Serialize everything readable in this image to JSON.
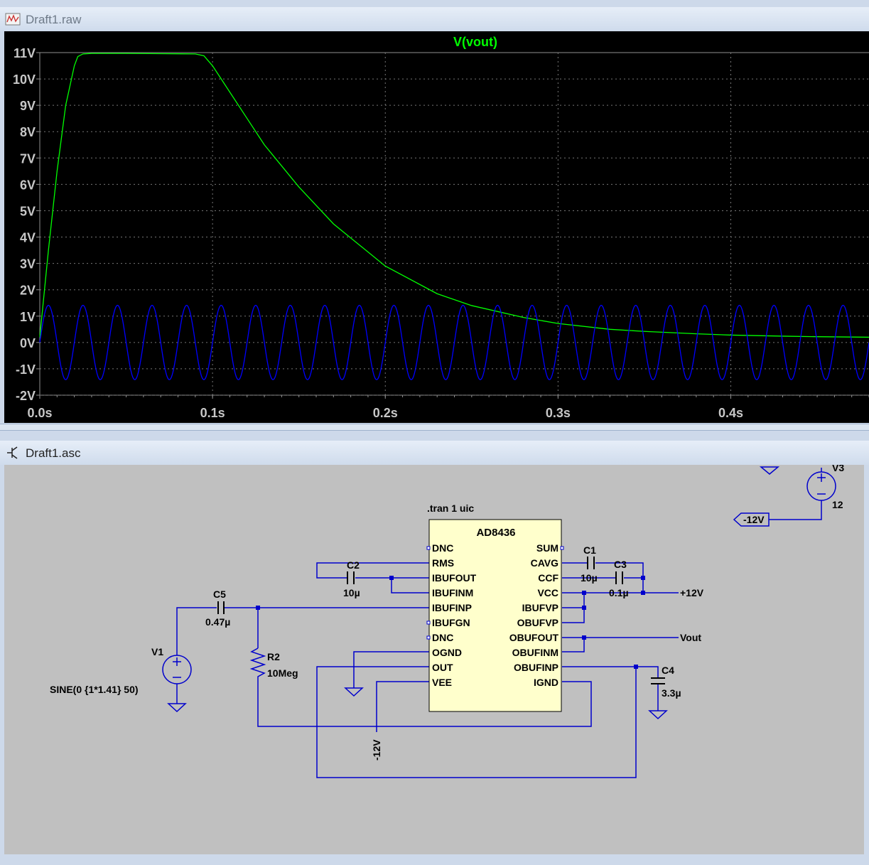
{
  "waveform_window": {
    "title": "Draft1.raw",
    "trace_label": "V(vout)"
  },
  "schematic_window": {
    "title": "Draft1.asc",
    "directive": ".tran 1 uic",
    "ic": {
      "name": "AD8436",
      "left_pins": [
        "DNC",
        "RMS",
        "IBUFOUT",
        "IBUFINM",
        "IBUFINP",
        "IBUFGN",
        "DNC",
        "OGND",
        "OUT",
        "VEE"
      ],
      "right_pins": [
        "SUM",
        "CAVG",
        "CCF",
        "VCC",
        "IBUFVP",
        "OBUFVP",
        "OBUFOUT",
        "OBUFINM",
        "OBUFINP",
        "IGND"
      ]
    },
    "components": {
      "c1": {
        "name": "C1",
        "value": "10µ"
      },
      "c2": {
        "name": "C2",
        "value": "10µ"
      },
      "c3": {
        "name": "C3",
        "value": "0.1µ"
      },
      "c4": {
        "name": "C4",
        "value": "3.3µ"
      },
      "c5": {
        "name": "C5",
        "value": "0.47µ"
      },
      "r2": {
        "name": "R2",
        "value": "10Meg"
      },
      "v1": {
        "name": "V1",
        "value": "SINE(0 {1*1.41} 50)"
      },
      "v3": {
        "name": "V3",
        "value": "12"
      }
    },
    "net_labels": {
      "plus12": "+12V",
      "minus12_flag": "-12V",
      "minus12_vee": "-12V",
      "vout": "Vout"
    }
  },
  "chart_data": {
    "type": "line",
    "title": "V(vout)",
    "x_ticks": [
      "0.0s",
      "0.1s",
      "0.2s",
      "0.3s",
      "0.4s"
    ],
    "y_ticks": [
      "11V",
      "10V",
      "9V",
      "8V",
      "7V",
      "6V",
      "5V",
      "4V",
      "3V",
      "2V",
      "1V",
      "0V",
      "-1V",
      "-2V"
    ],
    "xlim": [
      0,
      0.48
    ],
    "ylim": [
      -2,
      11
    ],
    "grid": true,
    "series": [
      {
        "name": "V(vout)",
        "color": "#00ff00",
        "x": [
          0,
          0.005,
          0.01,
          0.015,
          0.02,
          0.022,
          0.025,
          0.03,
          0.05,
          0.07,
          0.09,
          0.095,
          0.1,
          0.11,
          0.12,
          0.13,
          0.15,
          0.17,
          0.2,
          0.23,
          0.25,
          0.28,
          0.3,
          0.33,
          0.35,
          0.38,
          0.4,
          0.43,
          0.45,
          0.48
        ],
        "y": [
          0.2,
          3.5,
          6.5,
          9.0,
          10.5,
          10.85,
          10.95,
          10.97,
          10.97,
          10.96,
          10.95,
          10.88,
          10.5,
          9.5,
          8.5,
          7.5,
          5.9,
          4.5,
          2.9,
          1.85,
          1.4,
          0.95,
          0.72,
          0.5,
          0.42,
          0.33,
          0.28,
          0.24,
          0.22,
          0.2
        ]
      },
      {
        "name": "",
        "color": "#0000ff",
        "function": "sine",
        "amplitude": 1.41,
        "frequency_hz": 50,
        "offset": 0
      }
    ]
  },
  "colors": {
    "trace_green": "#00ff00",
    "wire_blue": "#0000cc",
    "ic_fill": "#ffffcc",
    "schematic_bg": "#c0c0c0",
    "plot_bg": "#000000",
    "grid": "#808080"
  }
}
